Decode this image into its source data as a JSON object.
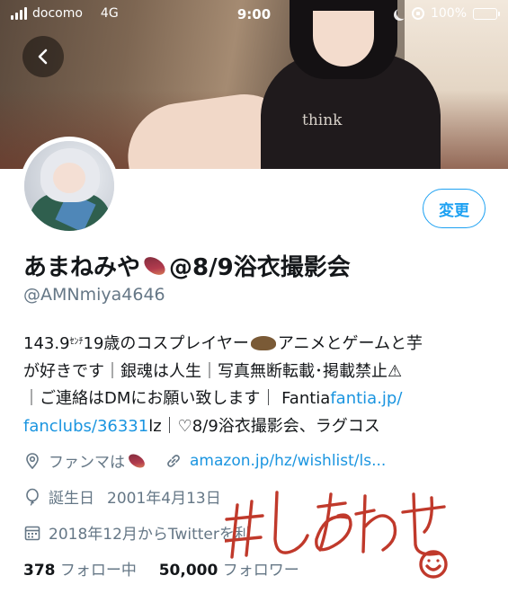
{
  "status_bar": {
    "carrier": "docomo",
    "network": "4G",
    "time": "9:00",
    "battery": "100%",
    "battery_level": 1.0
  },
  "profile": {
    "display_name": "あまねみや",
    "display_name_suffix": "@8/9浴衣撮影会",
    "handle": "@AMNmiya4646",
    "edit_label": "変更"
  },
  "bio": {
    "l1_a": "143.9",
    "l1_unit": "ｾﾝﾁ",
    "l1_b": "19歳のコスプレイヤー",
    "l1_c": "アニメとゲームと芋",
    "l2": "が好きです｜銀魂は人生｜写真無断転載･掲載禁止⚠",
    "l3_a": "｜ご連絡はDMにお願い致します｜ Fantia",
    "l3_link": "fantia.jp/",
    "l4_link": "fanclubs/36331",
    "l4_b": "lz｜♡8/9浴衣撮影会、ラグコス"
  },
  "meta": {
    "location": "ファンマは",
    "website": "amazon.jp/hz/wishlist/ls...",
    "birthday_label": "誕生日",
    "birthday": "2001年4月13日",
    "joined": "2018年12月からTwitterを利"
  },
  "stats": {
    "following_count": "378",
    "following_label": "フォロー中",
    "followers_count": "50,000",
    "followers_label": "フォロワー"
  },
  "stamp": {
    "text": "#しあわせ"
  },
  "icons": {
    "back": "chevron-left-icon",
    "location": "location-pin-icon",
    "link": "link-icon",
    "birthday": "balloon-icon",
    "calendar": "calendar-icon"
  },
  "colors": {
    "accent": "#1da1f2",
    "link": "#1b95e0",
    "secondary_text": "#657786",
    "stamp": "#c0392b"
  }
}
